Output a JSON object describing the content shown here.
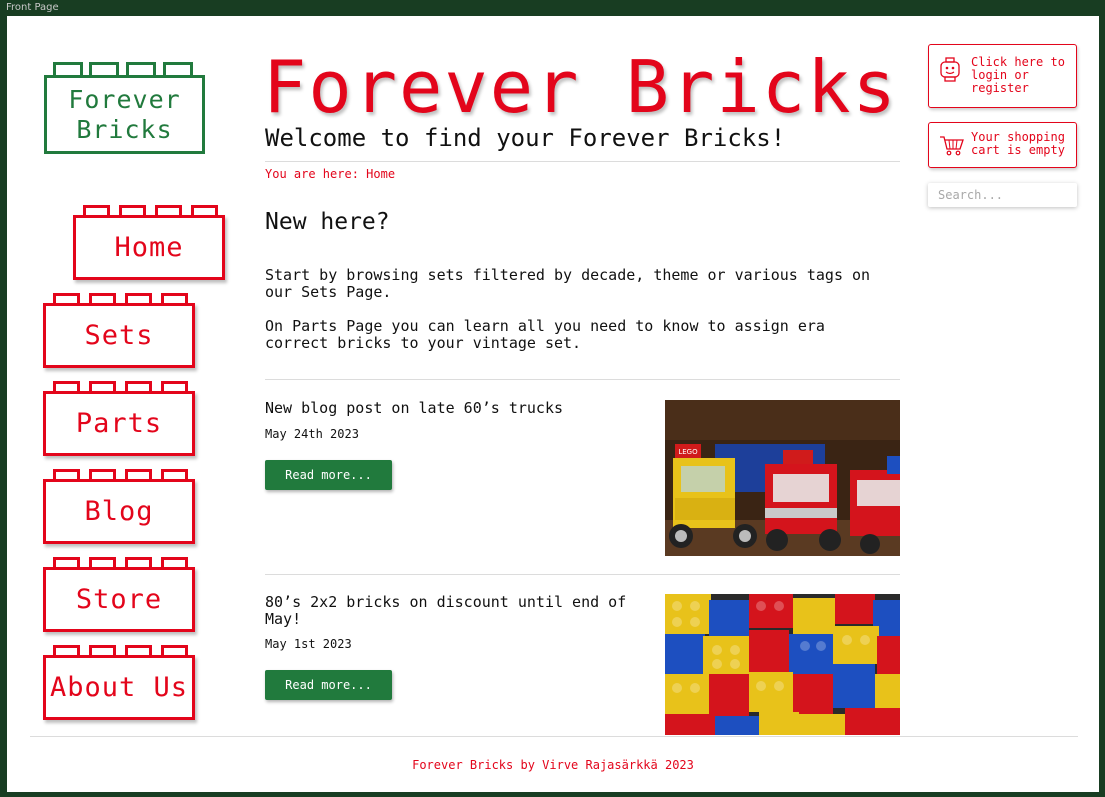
{
  "window": {
    "title": "Front Page"
  },
  "logo": {
    "line1": "Forever",
    "line2": "Bricks"
  },
  "header": {
    "title": "Forever Bricks",
    "welcome": "Welcome to find your Forever Bricks!",
    "breadcrumb": "You are here: Home"
  },
  "nav": {
    "items": [
      {
        "label": "Home"
      },
      {
        "label": "Sets"
      },
      {
        "label": "Parts"
      },
      {
        "label": "Blog"
      },
      {
        "label": "Store"
      },
      {
        "label": "About Us"
      }
    ],
    "active": "Home"
  },
  "intro": {
    "heading": "New here?",
    "p1": "Start by browsing sets filtered by decade, theme or various tags on our Sets Page.",
    "p2": "On Parts Page you can learn all you need to know to assign era correct bricks to your vintage set."
  },
  "posts": [
    {
      "title": "New blog post on late 60’s trucks",
      "date": "May 24th 2023",
      "button": "Read more...",
      "image_label": "LEGO"
    },
    {
      "title": "80’s 2x2 bricks on discount until end of May!",
      "date": "May 1st 2023",
      "button": "Read more..."
    }
  ],
  "account": {
    "login_text": "Click here to login or register",
    "icon": "lego-head-icon"
  },
  "cart": {
    "text": "Your shopping cart is empty",
    "icon": "shopping-cart-icon"
  },
  "search": {
    "placeholder": "Search..."
  },
  "footer": {
    "text": "Forever Bricks by Virve Rajasärkkä 2023"
  },
  "colors": {
    "red": "#e3051b",
    "green": "#217a3d",
    "frame": "#183d22"
  }
}
